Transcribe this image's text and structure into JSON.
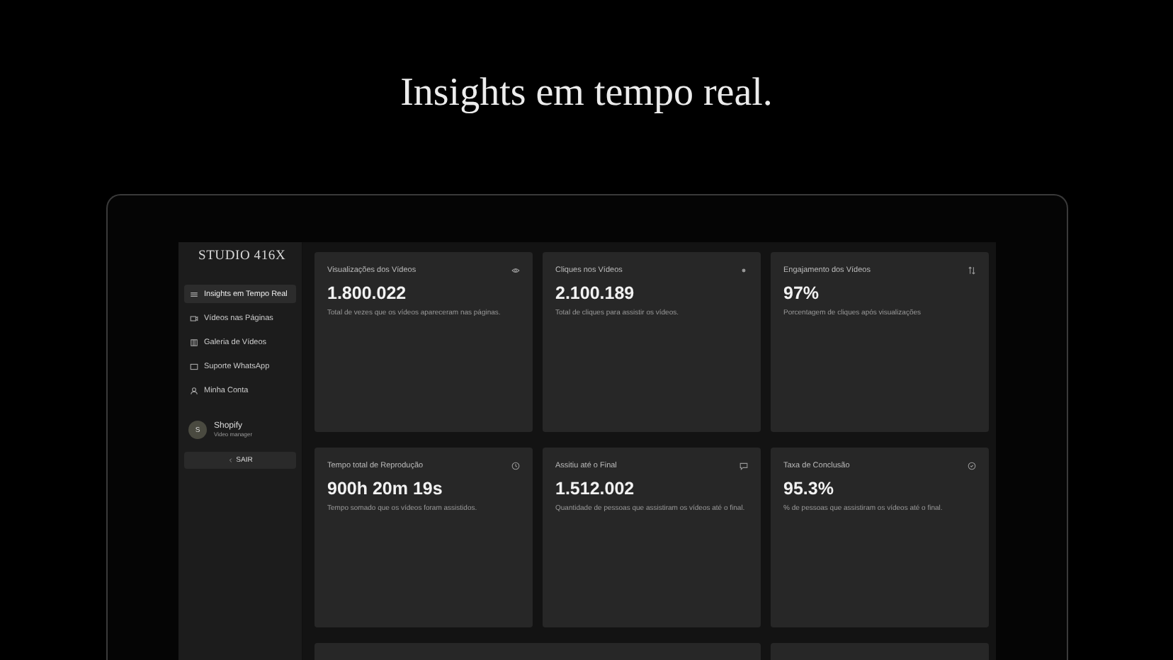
{
  "headline": "Insights em tempo real.",
  "sidebar": {
    "logo": "STUDIO 416X",
    "items": [
      {
        "label": "Insights em Tempo Real",
        "selected": true
      },
      {
        "label": "Vídeos nas Páginas",
        "selected": false
      },
      {
        "label": "Galeria de Vídeos",
        "selected": false
      },
      {
        "label": "Suporte WhatsApp",
        "selected": false
      },
      {
        "label": "Minha Conta",
        "selected": false
      }
    ],
    "user": {
      "initial": "S",
      "name": "Shopify",
      "role": "Video manager"
    },
    "logout": "SAIR"
  },
  "cards": [
    {
      "title": "Visualizações dos Vídeos",
      "value": "1.800.022",
      "description": "Total de vezes que os vídeos apareceram nas páginas."
    },
    {
      "title": "Cliques nos Vídeos",
      "value": "2.100.189",
      "description": "Total de cliques para assistir os vídeos."
    },
    {
      "title": "Engajamento dos Vídeos",
      "value": "97%",
      "description": "Porcentagem de cliques após visualizações"
    },
    {
      "title": "Tempo total de Reprodução",
      "value": "900h 20m 19s",
      "description": "Tempo somado que os vídeos foram assistidos."
    },
    {
      "title": "Assitiu até o Final",
      "value": "1.512.002",
      "description": "Quantidade de pessoas que assistiram os vídeos até o final."
    },
    {
      "title": "Taxa de Conclusão",
      "value": "95.3%",
      "description": "% de pessoas que assistiram os vídeos até o final."
    }
  ]
}
